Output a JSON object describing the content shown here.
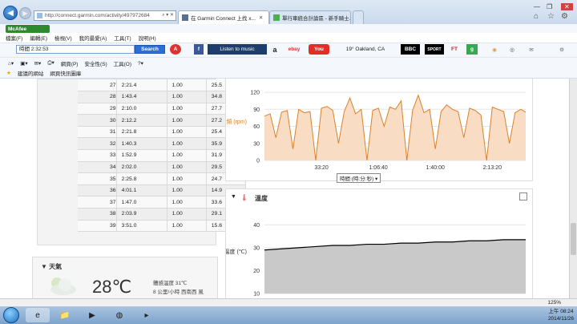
{
  "browser": {
    "address": "http://connect.garmin.com/activity/497972684",
    "tabs": [
      {
        "label": "在 Garmin Connect 上找 x..."
      },
      {
        "label": "單行車統合計論區 - 新手騎士..."
      }
    ],
    "menu": [
      "檔案(F)",
      "編輯(E)",
      "檢視(V)",
      "我的最愛(A)",
      "工具(T)",
      "說明(H)"
    ],
    "mcafee": "McAfee",
    "search_value": "時間 2:32:53",
    "search_button": "Search",
    "toolbar_items": [
      "Listen to music",
      "19° Oakland, CA"
    ],
    "toolbar3": [
      "網頁(P)",
      "安全性(S)",
      "工具(O)"
    ],
    "favorites": [
      "建議的網站",
      "網頁快訊圖庫"
    ],
    "zoom": "125%"
  },
  "laps": {
    "rows": [
      [
        "27",
        "2:21.4",
        "1.00",
        "25.5"
      ],
      [
        "28",
        "1:43.4",
        "1.00",
        "34.8"
      ],
      [
        "29",
        "2:10.0",
        "1.00",
        "27.7"
      ],
      [
        "30",
        "2:12.2",
        "1.00",
        "27.2"
      ],
      [
        "31",
        "2:21.8",
        "1.00",
        "25.4"
      ],
      [
        "32",
        "1:40.3",
        "1.00",
        "35.9"
      ],
      [
        "33",
        "1:52.9",
        "1.00",
        "31.9"
      ],
      [
        "34",
        "2:02.0",
        "1.00",
        "29.5"
      ],
      [
        "35",
        "2:25.8",
        "1.00",
        "24.7"
      ],
      [
        "36",
        "4:01.1",
        "1.00",
        "14.9"
      ],
      [
        "37",
        "1:47.0",
        "1.00",
        "33.6"
      ],
      [
        "38",
        "2:03.9",
        "1.00",
        "29.1"
      ],
      [
        "39",
        "3:51.0",
        "1.00",
        "15.6"
      ]
    ]
  },
  "weather": {
    "title": "天氣",
    "temperature": "28℃",
    "feels_like": "體感溫度 31℃",
    "wind": "8 公里/小時 西南西 風"
  },
  "cadence_chart": {
    "ylabel": "踏頻 (rpm)",
    "axis_select": "時間 (時:分:秒)"
  },
  "temp_panel": {
    "title": "溫度",
    "ylabel": "溫度 (℃)"
  },
  "clock": {
    "time": "上午 08:24",
    "date": "2014/11/26"
  },
  "chart_data": [
    {
      "type": "area",
      "ylabel": "踏頻 (rpm)",
      "ylim": [
        0,
        130
      ],
      "yticks": [
        0,
        30,
        60,
        90,
        120
      ],
      "xticks": [
        "33:20",
        "1:06:40",
        "1:40:00",
        "2:13:20"
      ],
      "x": [
        0,
        200,
        400,
        600,
        800,
        1000,
        1200,
        1400,
        1600,
        1800,
        2000,
        2200,
        2400,
        2600,
        2800,
        3000,
        3200,
        3400,
        3600,
        3800,
        4000,
        4200,
        4400,
        4600,
        4800,
        5000,
        5200,
        5400,
        5600,
        5800,
        6000,
        6200,
        6400,
        6600,
        6800,
        7000,
        7200,
        7400,
        7600,
        7800,
        8000,
        8200,
        8400,
        8600,
        8800,
        9000,
        9173
      ],
      "values": [
        78,
        82,
        40,
        85,
        88,
        20,
        90,
        84,
        86,
        0,
        92,
        95,
        88,
        30,
        86,
        110,
        82,
        90,
        0,
        88,
        92,
        60,
        94,
        90,
        105,
        0,
        88,
        115,
        84,
        90,
        20,
        86,
        98,
        90,
        86,
        40,
        92,
        88,
        80,
        0,
        94,
        90,
        86,
        30,
        84,
        90,
        85
      ]
    },
    {
      "type": "area",
      "ylabel": "溫度 (℃)",
      "ylim": [
        10,
        45
      ],
      "yticks": [
        10,
        20,
        30,
        40
      ],
      "xticks": [
        "33:20",
        "1:06:40",
        "1:40:00",
        "2:13:20"
      ],
      "x": [
        0,
        600,
        1200,
        1800,
        2400,
        3000,
        3600,
        4200,
        4800,
        5400,
        6000,
        6600,
        7200,
        7800,
        8400,
        9173
      ],
      "values": [
        29,
        29.5,
        30,
        30.5,
        31,
        31,
        31.5,
        31.5,
        32,
        32,
        32.5,
        32.5,
        33,
        33,
        33.5,
        33.5
      ]
    }
  ]
}
